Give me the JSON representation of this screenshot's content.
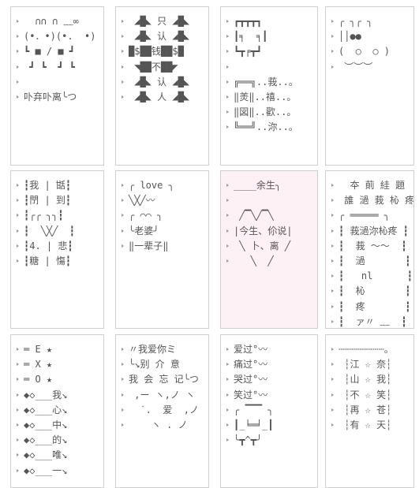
{
  "cards": [
    {
      "lines": [
        "  ∩∩ ∩ ﹏∞",
        "(•．•)(•.  •)",
        "┗ ■ / ■ ┛",
        " ┛ ┗  ┛ ┗",
        "",
        "卟弃卟离╰つ"
      ]
    },
    {
      "lines": [
        " ◢█◣ 只 ◢█◣",
        " ◢█◣ 认 ◢█◣",
        "█$██钱██$█",
        " ◥██不██◤",
        " ◢█◣ 认 ◢█◣",
        " ◢█◣ 人 ◢█◣"
      ]
    },
    {
      "lines": [
        "┏┳┳┳┓",
        "┃╕  ╕┃",
        "┗┳╒┳┛",
        "",
        "╔══╗..莪..。",
        "‖羙‖..禧..。",
        "‖図‖..歡..。",
        "╚══╝..沵..。"
      ]
    },
    {
      "lines": [
        "╭ ╮╭ ╮",
        "││●●",
        "(  ○  ○ )",
        " ︶︶︶"
      ]
    },
    {
      "lines": [
        "┇我 | 甛┇",
        "┇閅 | 到┇",
        "┇╭╭ ╮╮┇",
        "┇  ╲╳╱  ┇",
        "┇4. | 悲┇",
        "┇糖 | 慯┇"
      ]
    },
    {
      "lines": [
        "╭ love ╮",
        "╲╳╱〰",
        "╭ ⌒⌒ ╮",
        "╰老婆╯",
        "‖一辈子‖"
      ]
    },
    {
      "lines": [
        "____余生╮",
        "",
        " ╱▔╲╱▔╲",
        "|今生、伱说|",
        " ╲ 卜、离 ╱",
        "   ╲  ╱"
      ]
    },
    {
      "lines": [
        "  夲 萴 絓 題",
        " 誰 濄 莪 杺 疼",
        "╭ ═════ ╮",
        "┇ 莪濄沵杺疼 ┇",
        "┇  莪 ～～  ┇",
        "┇  濄       ┇",
        "┇   nl      ┇",
        "┇  杺       ┇",
        "┇  疼       ┇",
        "┇  ァ〃 ﹏  ┇"
      ]
    },
    {
      "lines": [
        "═ E ★",
        "═ X ★",
        "═ O ★",
        "◆◇___我↘",
        "◆◇___心↘",
        "◆◇___中↘",
        "◆◇___的↘",
        "◆◇___唯↘",
        "◆◇___一↘"
      ]
    },
    {
      "lines": [
        "〃我爱你ミ",
        "╰↘别 介 意",
        "我 会 忘 记╰つ",
        " ,ー ヽ,ノ ヽ",
        "  ˙.  爱  ,ノ",
        "    ヽ . ノ"
      ]
    },
    {
      "lines": [
        "爱过°〰",
        "痛过°〰",
        "哭过°〰",
        "笑过°〰",
        "╭ ▔▔▔ ╮",
        "┃_╘═╛_┃",
        "╰┳^┳╯"
      ]
    },
    {
      "lines": [
        "┄┄┄┄┄┄┄┄。",
        " ┆江 ☆ 奈┆",
        " ┆山 ☆ 我┆",
        " ┆不 ☆ 笑┆",
        " ┆再 ☆ 苍┆",
        " ┆有 ☆ 天┆"
      ]
    }
  ],
  "colors": {
    "border": "#cfcfcf",
    "highlight_bg": "#fdf1f6",
    "text": "#555555"
  }
}
